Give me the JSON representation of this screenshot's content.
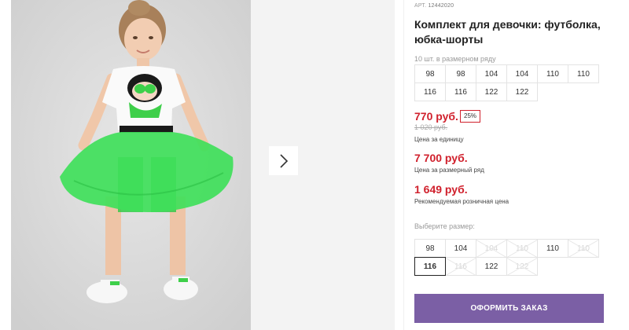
{
  "product": {
    "sku_label": "АРТ.",
    "sku_value": "12442020",
    "title": "Комплект для девочки: футболка, юбка-шорты"
  },
  "pack": {
    "label": "10 шт. в размерном ряду",
    "sizes": [
      "98",
      "98",
      "104",
      "104",
      "110",
      "110",
      "116",
      "116",
      "122",
      "122"
    ]
  },
  "pricing": {
    "unit_price": "770 руб.",
    "discount": "25%",
    "old_price": "1 020 руб.",
    "unit_caption": "Цена за единицу",
    "pack_price": "7 700 руб.",
    "pack_caption": "Цена за размерный ряд",
    "retail_price": "1 649 руб.",
    "retail_caption": "Рекомендуемая розничная цена"
  },
  "size_selector": {
    "label": "Выберите размер:",
    "options": [
      {
        "label": "98",
        "state": "available"
      },
      {
        "label": "104",
        "state": "available"
      },
      {
        "label": "104",
        "state": "unavailable"
      },
      {
        "label": "110",
        "state": "unavailable"
      },
      {
        "label": "110",
        "state": "available"
      },
      {
        "label": "110",
        "state": "unavailable"
      },
      {
        "label": "116",
        "state": "selected"
      },
      {
        "label": "116",
        "state": "unavailable"
      },
      {
        "label": "122",
        "state": "available"
      },
      {
        "label": "122",
        "state": "unavailable"
      }
    ]
  },
  "actions": {
    "order_label": "ОФОРМИТЬ ЗАКАЗ"
  },
  "gallery": {
    "next_icon": "chevron-right-icon"
  },
  "colors": {
    "accent_red": "#d0202c",
    "button_purple": "#7b5fa5"
  }
}
